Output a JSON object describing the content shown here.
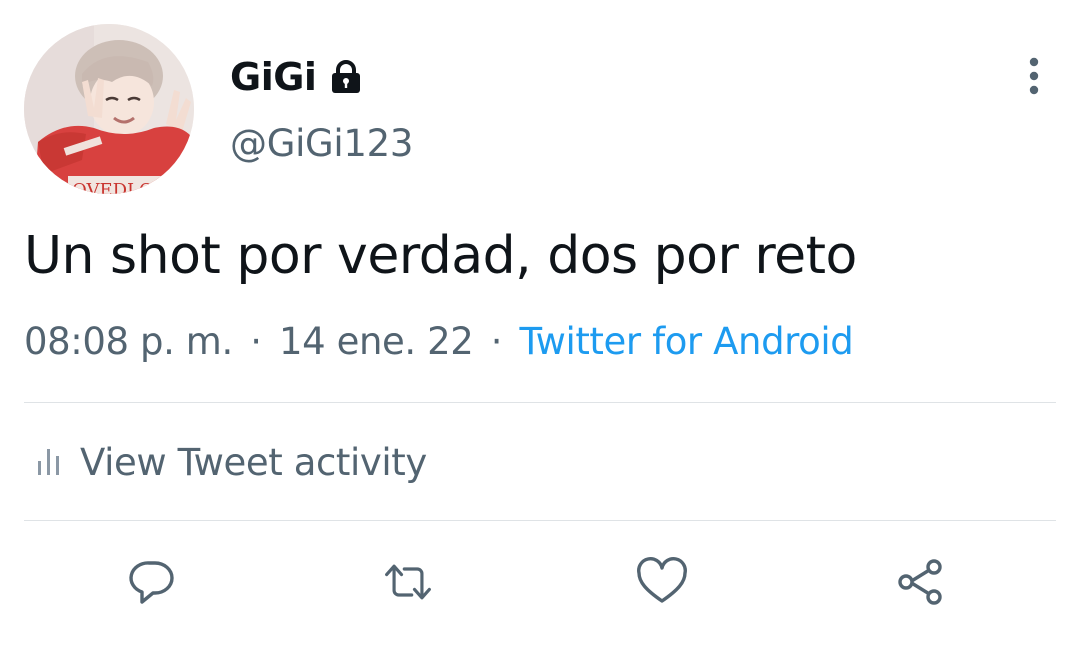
{
  "user": {
    "display_name": "GiGi",
    "handle": "@GiGi123",
    "protected_icon": "lock-icon",
    "avatar_shirt_text": "OVEDLOVE"
  },
  "tweet": {
    "text": "Un shot por verdad, dos por reto",
    "time": "08:08 p. m.",
    "separator": "·",
    "date": "14 ene. 22",
    "source": "Twitter for Android"
  },
  "activity": {
    "label": "View Tweet activity",
    "icon": "bar-chart-icon"
  },
  "actions": {
    "reply_icon": "reply-icon",
    "retweet_icon": "retweet-icon",
    "like_icon": "heart-icon",
    "share_icon": "share-icon"
  },
  "colors": {
    "text_primary": "#0f1419",
    "text_secondary": "#536471",
    "link": "#1d9bf0",
    "divider": "#dfe3e6"
  }
}
